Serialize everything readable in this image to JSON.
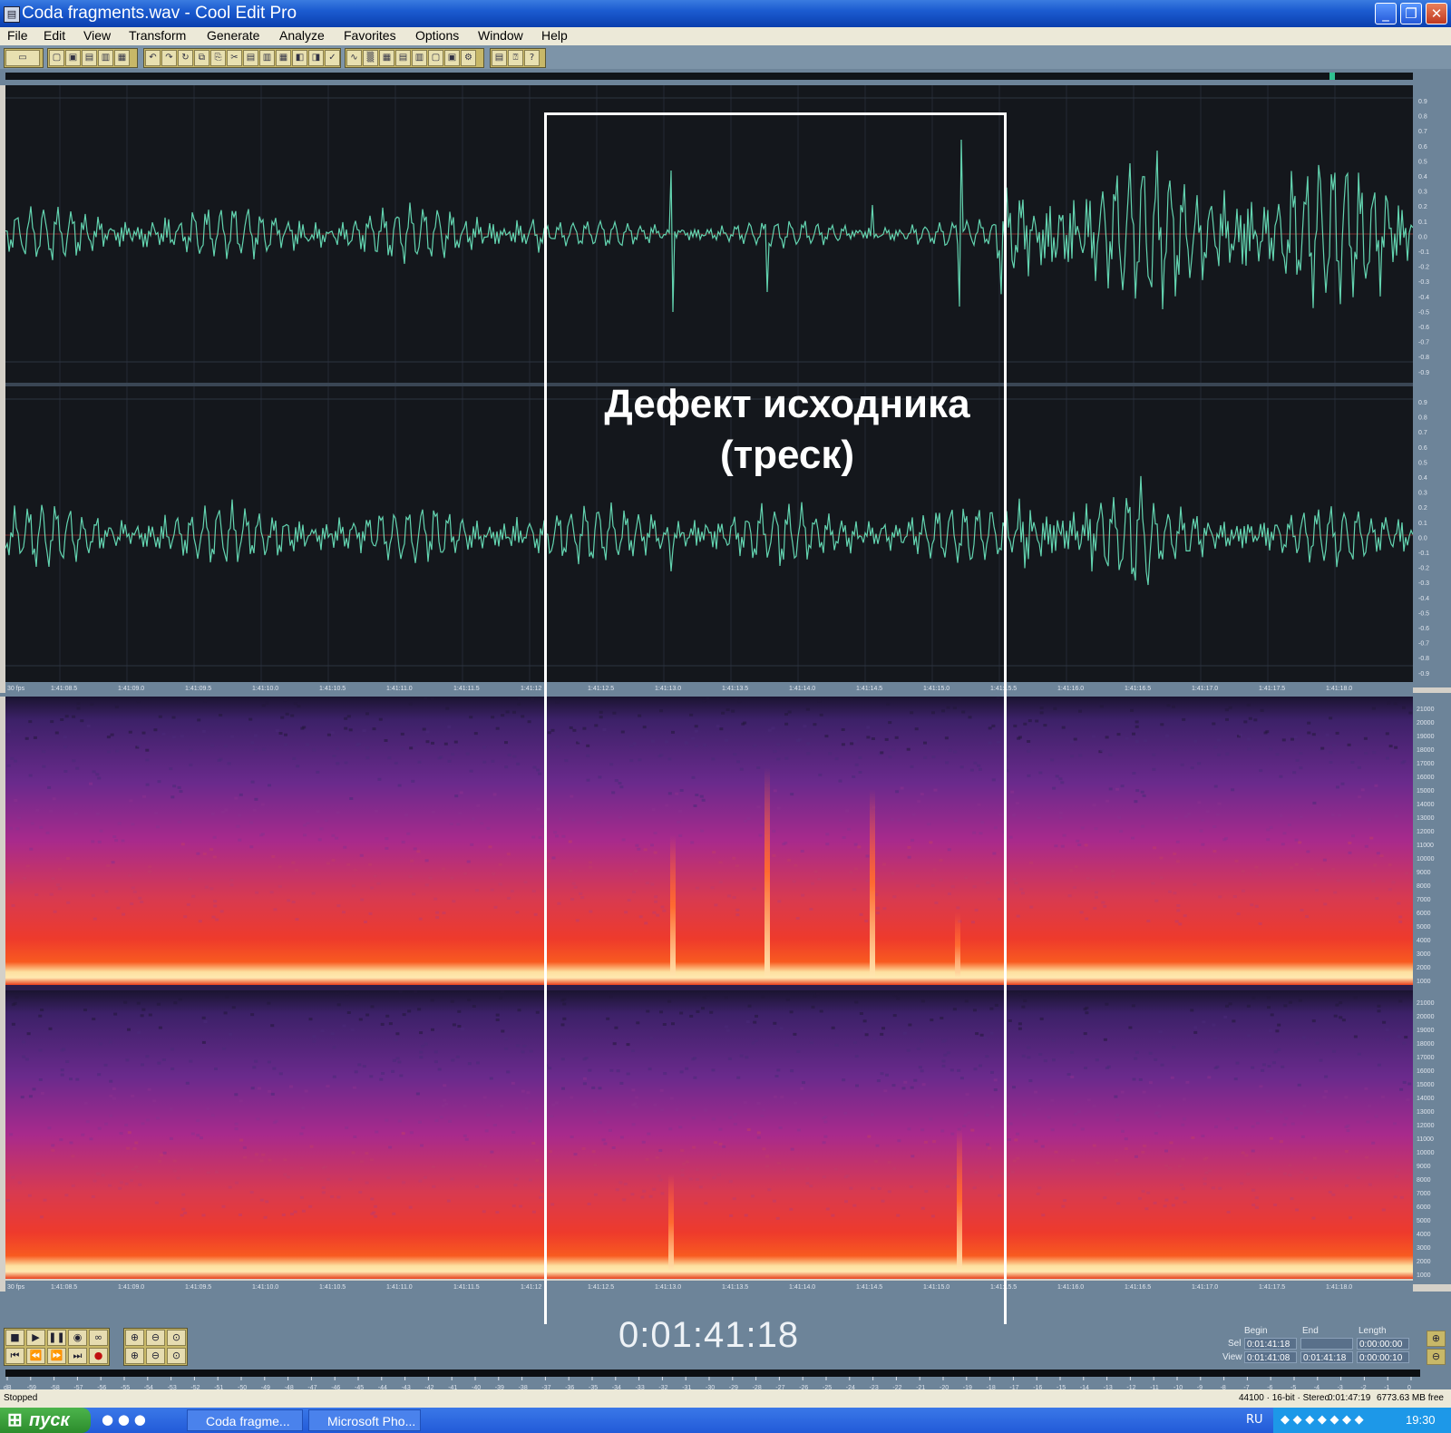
{
  "window": {
    "title": "Coda fragments.wav - Cool Edit Pro"
  },
  "menu": [
    "File",
    "Edit",
    "View",
    "Transform",
    "Generate",
    "Analyze",
    "Favorites",
    "Options",
    "Window",
    "Help"
  ],
  "annotation": {
    "line1": "Дефект исходника",
    "line2": "(треск)"
  },
  "waveform": {
    "amplitude_labels": [
      "0.9",
      "0.8",
      "0.7",
      "0.6",
      "0.5",
      "0.4",
      "0.3",
      "0.2",
      "0.1",
      "0.0",
      "-0.1",
      "-0.2",
      "-0.3",
      "-0.4",
      "-0.5",
      "-0.6",
      "-0.7",
      "-0.8",
      "-0.9"
    ],
    "time_labels": [
      "1:41:08.5",
      "1:41:09.0",
      "1:41:09.5",
      "1:41:10.0",
      "1:41:10.5",
      "1:41:11.0",
      "1:41:11.5",
      "1:41:12",
      "1:41:12.5",
      "1:41:13.0",
      "1:41:13.5",
      "1:41:14.0",
      "1:41:14.5",
      "1:41:15.0",
      "1:41:15.5",
      "1:41:16.0",
      "1:41:16.5",
      "1:41:17.0",
      "1:41:17.5",
      "1:41:18.0"
    ],
    "fps_label": "30 fps"
  },
  "spectral": {
    "freq_labels": [
      "21000",
      "20000",
      "19000",
      "18000",
      "17000",
      "16000",
      "15000",
      "14000",
      "13000",
      "12000",
      "11000",
      "10000",
      "9000",
      "8000",
      "7000",
      "6000",
      "5000",
      "4000",
      "3000",
      "2000",
      "1000"
    ],
    "fps_label": "30 fps"
  },
  "transport": {
    "timecode": "0:01:41:18",
    "sel": {
      "headers": [
        "Begin",
        "End",
        "Length"
      ],
      "row_sel_label": "Sel",
      "row_view_label": "View",
      "sel_values": [
        "0:01:41:18",
        "",
        "0:00:00:00"
      ],
      "view_values": [
        "0:01:41:08",
        "0:01:41:18",
        "0:00:00:10"
      ]
    }
  },
  "level_labels": [
    "dB",
    "-59",
    "-58",
    "-57",
    "-56",
    "-55",
    "-54",
    "-53",
    "-52",
    "-51",
    "-50",
    "-49",
    "-48",
    "-47",
    "-46",
    "-45",
    "-44",
    "-43",
    "-42",
    "-41",
    "-40",
    "-39",
    "-38",
    "-37",
    "-36",
    "-35",
    "-34",
    "-33",
    "-32",
    "-31",
    "-30",
    "-29",
    "-28",
    "-27",
    "-26",
    "-25",
    "-24",
    "-23",
    "-22",
    "-21",
    "-20",
    "-19",
    "-18",
    "-17",
    "-16",
    "-15",
    "-14",
    "-13",
    "-12",
    "-11",
    "-10",
    "-9",
    "-8",
    "-7",
    "-6",
    "-5",
    "-4",
    "-3",
    "-2",
    "-1",
    "0"
  ],
  "status": {
    "state": "Stopped",
    "format": "44100 · 16-bit · Stereo",
    "duration": "0:01:47:19",
    "free": "6773.63 MB free"
  },
  "taskbar": {
    "start": "пуск",
    "items": [
      "Coda fragme...",
      "Microsoft Pho..."
    ],
    "lang": "RU",
    "clock": "19:30"
  }
}
